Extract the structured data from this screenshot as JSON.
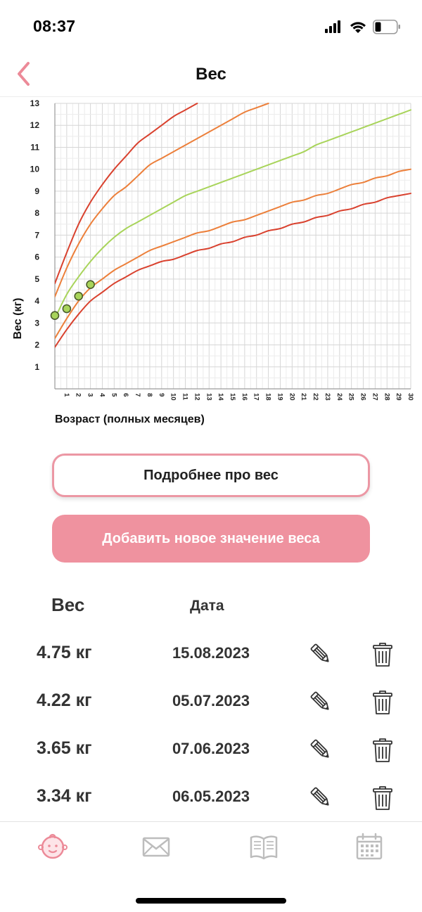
{
  "status": {
    "time": "08:37"
  },
  "header": {
    "title": "Вес"
  },
  "chart_data": {
    "type": "line",
    "ylabel": "Вес (кг)",
    "xlabel": "Возраст (полных месяцев)",
    "xlim": [
      0,
      30
    ],
    "ylim": [
      0,
      13
    ],
    "x_ticks": [
      1,
      2,
      3,
      4,
      5,
      6,
      7,
      8,
      9,
      10,
      11,
      12,
      13,
      14,
      15,
      16,
      17,
      18,
      19,
      20,
      21,
      22,
      23,
      24,
      25,
      26,
      27,
      28,
      29,
      30
    ],
    "y_ticks": [
      1,
      2,
      3,
      4,
      5,
      6,
      7,
      8,
      9,
      10,
      11,
      12,
      13
    ],
    "grid": true,
    "series": [
      {
        "color": "#d9412e",
        "x": [
          0,
          1,
          2,
          3,
          4,
          5,
          6,
          7,
          8,
          9,
          10,
          11,
          12,
          13,
          14,
          15,
          16,
          17,
          18,
          19,
          20,
          21,
          22,
          23,
          24,
          25,
          26,
          27,
          28,
          29,
          30
        ],
        "values": [
          1.9,
          2.7,
          3.4,
          4.0,
          4.4,
          4.8,
          5.1,
          5.4,
          5.6,
          5.8,
          5.9,
          6.1,
          6.3,
          6.4,
          6.6,
          6.7,
          6.9,
          7.0,
          7.2,
          7.3,
          7.5,
          7.6,
          7.8,
          7.9,
          8.1,
          8.2,
          8.4,
          8.5,
          8.7,
          8.8,
          8.9
        ]
      },
      {
        "color": "#ec7f3a",
        "x": [
          0,
          1,
          2,
          3,
          4,
          5,
          6,
          7,
          8,
          9,
          10,
          11,
          12,
          13,
          14,
          15,
          16,
          17,
          18,
          19,
          20,
          21,
          22,
          23,
          24,
          25,
          26,
          27,
          28,
          29,
          30
        ],
        "values": [
          2.3,
          3.2,
          4.0,
          4.6,
          5.0,
          5.4,
          5.7,
          6.0,
          6.3,
          6.5,
          6.7,
          6.9,
          7.1,
          7.2,
          7.4,
          7.6,
          7.7,
          7.9,
          8.1,
          8.3,
          8.5,
          8.6,
          8.8,
          8.9,
          9.1,
          9.3,
          9.4,
          9.6,
          9.7,
          9.9,
          10.0
        ]
      },
      {
        "color": "#a8d45a",
        "x": [
          0,
          1,
          2,
          3,
          4,
          5,
          6,
          7,
          8,
          9,
          10,
          11,
          12,
          13,
          14,
          15,
          16,
          17,
          18,
          19,
          20,
          21,
          22,
          23,
          24,
          25,
          26,
          27,
          28,
          29,
          30
        ],
        "values": [
          3.2,
          4.3,
          5.1,
          5.8,
          6.4,
          6.9,
          7.3,
          7.6,
          7.9,
          8.2,
          8.5,
          8.8,
          9.0,
          9.2,
          9.4,
          9.6,
          9.8,
          10.0,
          10.2,
          10.4,
          10.6,
          10.8,
          11.1,
          11.3,
          11.5,
          11.7,
          11.9,
          12.1,
          12.3,
          12.5,
          12.7
        ]
      },
      {
        "color": "#ec7f3a",
        "x": [
          0,
          1,
          2,
          3,
          4,
          5,
          6,
          7,
          8,
          9,
          10,
          11,
          12,
          13,
          14,
          15,
          16,
          17,
          18
        ],
        "values": [
          4.2,
          5.5,
          6.6,
          7.5,
          8.2,
          8.8,
          9.2,
          9.7,
          10.2,
          10.5,
          10.8,
          11.1,
          11.4,
          11.7,
          12.0,
          12.3,
          12.6,
          12.8,
          13.0
        ]
      },
      {
        "color": "#d9412e",
        "x": [
          0,
          1,
          2,
          3,
          4,
          5,
          6,
          7,
          8,
          9,
          10,
          11,
          12
        ],
        "values": [
          4.8,
          6.2,
          7.5,
          8.5,
          9.3,
          10.0,
          10.6,
          11.2,
          11.6,
          12.0,
          12.4,
          12.7,
          13.0
        ]
      }
    ],
    "points": {
      "x": [
        0,
        1,
        2,
        3
      ],
      "values": [
        3.34,
        3.65,
        4.22,
        4.75
      ],
      "color": "#a8d45a"
    }
  },
  "actions": {
    "details_label": "Подробнее про вес",
    "add_label": "Добавить новое значение веса"
  },
  "table": {
    "weight_header": "Вес",
    "date_header": "Дата",
    "rows": [
      {
        "weight": "4.75 кг",
        "date": "15.08.2023"
      },
      {
        "weight": "4.22 кг",
        "date": "05.07.2023"
      },
      {
        "weight": "3.65 кг",
        "date": "07.06.2023"
      },
      {
        "weight": "3.34 кг",
        "date": "06.05.2023"
      }
    ]
  },
  "tabs": [
    {
      "icon": "baby-face-icon",
      "active": true
    },
    {
      "icon": "envelope-icon",
      "active": false
    },
    {
      "icon": "book-icon",
      "active": false
    },
    {
      "icon": "calendar-icon",
      "active": false
    }
  ],
  "colors": {
    "accent": "#ef929f",
    "accent_border": "#ec97a4",
    "inactive_icon": "#bdbdbd"
  }
}
